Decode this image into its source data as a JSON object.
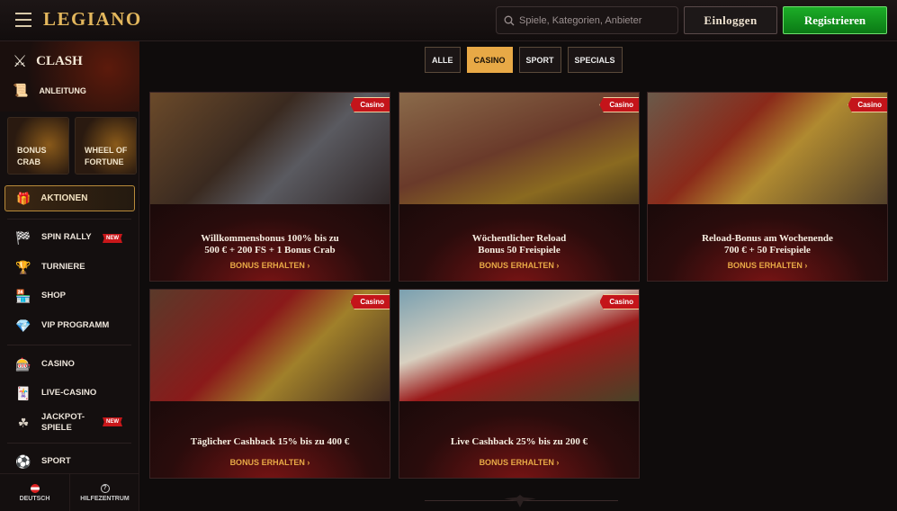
{
  "header": {
    "logo": "LEGIANO",
    "search_placeholder": "Spiele, Kategorien, Anbieter",
    "login_label": "Einloggen",
    "register_label": "Registrieren"
  },
  "sidebar": {
    "clash_label": "CLASH",
    "anleitung_label": "ANLEITUNG",
    "tile_bonus_crab": "Bonus Crab",
    "tile_wheel": "Wheel of Fortune",
    "aktionen_label": "AKTIONEN",
    "items": [
      {
        "label": "SPIN RALLY",
        "icon": "checkered-flag-icon",
        "badge": "NEW"
      },
      {
        "label": "TURNIERE",
        "icon": "trophy-icon"
      },
      {
        "label": "SHOP",
        "icon": "shop-icon"
      },
      {
        "label": "VIP PROGRAMM",
        "icon": "diamond-icon"
      },
      {
        "label": "CASINO",
        "icon": "slot-machine-icon"
      },
      {
        "label": "LIVE-CASINO",
        "icon": "cards-icon"
      },
      {
        "label": "JACKPOT-\nSPIELE",
        "icon": "clover-icon",
        "badge": "NEW"
      },
      {
        "label": "SPORT",
        "icon": "ball-icon"
      }
    ],
    "footer_language": "DEUTSCH",
    "footer_help": "HILFEZENTRUM"
  },
  "filters": [
    "ALLE",
    "CASINO",
    "SPORT",
    "SPECIALS"
  ],
  "active_filter": "CASINO",
  "cards": [
    {
      "ribbon": "Casino",
      "title": "Willkommensbonus 100% bis zu\n500 € + 200 FS + 1 Bonus Crab",
      "cta": "BONUS ERHALTEN"
    },
    {
      "ribbon": "Casino",
      "title": "Wöchentlicher Reload\nBonus 50 Freispiele",
      "cta": "BONUS ERHALTEN"
    },
    {
      "ribbon": "Casino",
      "title": "Reload-Bonus am Wochenende\n700 € + 50 Freispiele",
      "cta": "BONUS ERHALTEN"
    },
    {
      "ribbon": "Casino",
      "title": "Täglicher Cashback 15% bis zu 400 €",
      "cta": "BONUS ERHALTEN"
    },
    {
      "ribbon": "Casino",
      "title": "Live Cashback 25% bis zu 200 €",
      "cta": "BONUS ERHALTEN"
    }
  ],
  "colors": {
    "accent": "#e8a946",
    "register": "#1cad27",
    "ribbon": "#c4141a"
  }
}
